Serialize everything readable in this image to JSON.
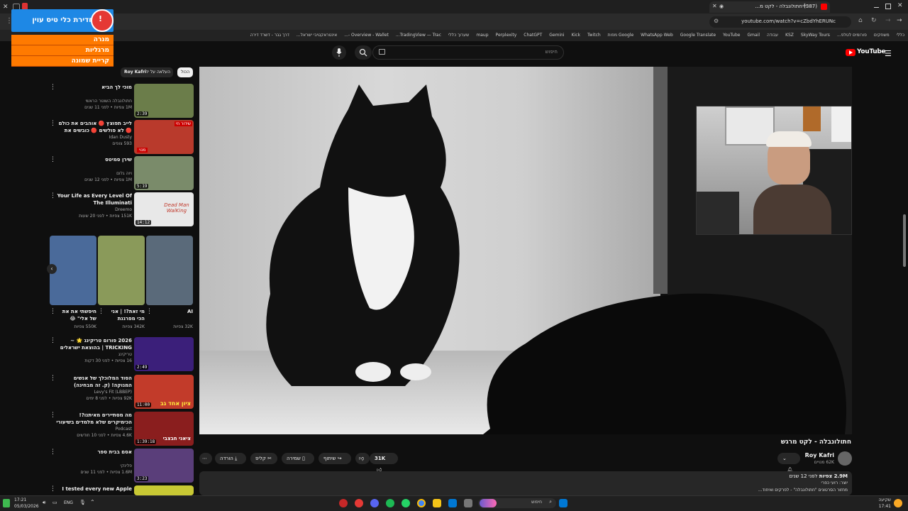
{
  "browser": {
    "tab_title": "(387) חתולונבלה - לקט מ...",
    "url": "youtube.com/watch?v=cZbdYhERUNc",
    "bookmarks": [
      "כללי",
      "משחקים",
      "פורומים לטלפ...",
      "SkyWay Tours",
      "KSZ",
      "עבודה",
      "Gmail",
      "YouTube",
      "Google Translate",
      "WhatsApp Web",
      "Google מפות",
      "Twitch",
      "Kick",
      "Gemini",
      "ChatGPT",
      "Perplexity",
      "maup",
      "שערוך כללי",
      "TradingView — Trac...",
      "Overview - Wallet -...",
      "אינטראקטיבי ישראל...",
      "דרך גבר - דשרד דירה"
    ]
  },
  "overlay": {
    "title": "חדירת כלי טיס עוין",
    "items": [
      "מנרה",
      "מרגליות",
      "קריית שמונה"
    ]
  },
  "youtube": {
    "logo_text": "YouTube",
    "search_placeholder": "חיפוש",
    "chips": {
      "all": "הכול",
      "from_uploader": "העלאה על ידי",
      "uploader_name": "Roy Kafri"
    },
    "recommendations": [
      {
        "title": "מוכי לך הביא",
        "channel": "חתולונבלה השוטר הראשי",
        "meta": "1M צפיות • לפני 11 שנים",
        "duration": "2:39"
      },
      {
        "title": "לייב תפוצץ 🔴 אוהבים את כולם 🔴 לא פולשים 🔴 כובשים את יותר...",
        "channel": "Idan Dusty",
        "meta": "593 צופים",
        "duration": ""
      },
      {
        "title": "שירן סמיטס",
        "channel": "ויוה גלום",
        "meta": "1M צפיות • לפני 12 שנים",
        "duration": "5:19"
      },
      {
        "title": "Your Life as Every Level Of The Illuminati",
        "channel": "Dreemo",
        "meta": "151K צפיות • לפני 20 שעות",
        "duration": "14:12"
      },
      {
        "title": "2026 פורום טריקינג 🌟 ~ TRICKING | בהוצאת ישראלים 🇮🇱",
        "channel": "טריקינג",
        "meta": "16 צפיות • לפני 30 דקות",
        "duration": "2:49"
      },
      {
        "title": "הסוד המלוכלך של אנשים המנוקה! (ק. זה מבחינה)",
        "channel": "Levy's Fit (LBBEP)",
        "meta": "92K צפיות • לפני 8 ימים",
        "duration": "11:00"
      },
      {
        "title": "מה מסתיירים מאיתנו?! הכימיקרים שלא מלמדים בשיעורי תנ\"ך עם יוזן ניז...",
        "channel": "Podcast",
        "meta": "4.6K צפיות • לפני 10 חודשים",
        "duration": "1:39:18"
      },
      {
        "title": "אסם בבית ספר",
        "channel": "פלינקי",
        "meta": "1.6M צפיות • לפני 11 שנים",
        "duration": "3:23"
      },
      {
        "title": "I tested every new Apple",
        "channel": "",
        "meta": "",
        "duration": ""
      }
    ],
    "shorts": [
      {
        "title": "AI",
        "views": "32K צפיות"
      },
      {
        "title": "מי זאת?! | אני הכי מפרגנת",
        "views": "342K צפיות"
      },
      {
        "title": "חיפשתי את את של אלי\" 😂",
        "views": "550K צפיות"
      }
    ],
    "thumb_texts": {
      "dead_man": "Dead Man WalKing",
      "live_badge": "שידור חי",
      "sub_badge": "מנוי",
      "zionism": "ציון אחד גב",
      "shirt": "ציאני חבצבי"
    },
    "video": {
      "title": "חתולונבלה - לקט מרגש",
      "channel": "Roy Kafri",
      "subscribers": "62K מנויים",
      "likes": "31K",
      "actions": {
        "share": "שיתוף",
        "save": "שמירה",
        "clip": "קליפ",
        "download": "הורדה"
      },
      "views": "2.9M צפיות",
      "age": "לפני 12 שנים",
      "desc1": "יוצר: רועי כפרי",
      "desc2": "מחזור הסרטונים \"חתולונבלה\" - לפרקים ואיחוד..."
    }
  },
  "taskbar": {
    "time": "17:21",
    "date": "05/03/2026",
    "lang": "ENG",
    "search_label": "חיפוש",
    "weather_label": "שקיעה",
    "weather_time": "17:41"
  },
  "colors": {
    "yt_red": "#ff0000",
    "overlay_orange": "#ff7a00",
    "overlay_blue": "#1e88e5"
  }
}
